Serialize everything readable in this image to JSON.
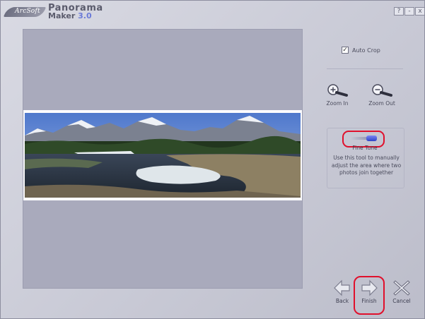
{
  "app": {
    "brand": "ArcSoft",
    "name_line1": "Panorama",
    "name_line2": "Maker",
    "version": "3.0"
  },
  "window_controls": {
    "help": "?",
    "minimize": "-",
    "close": "x"
  },
  "options": {
    "auto_crop_label": "Auto Crop",
    "auto_crop_checked": true
  },
  "zoom": {
    "zoom_in_label": "Zoom In",
    "zoom_out_label": "Zoom Out"
  },
  "fine_tune": {
    "label": "Fine Tune",
    "description": "Use this tool to manually adjust the area where two photos join together"
  },
  "nav": {
    "back_label": "Back",
    "finish_label": "Finish",
    "cancel_label": "Cancel"
  },
  "colors": {
    "highlight": "#e0102c",
    "accent": "#6b7bd8",
    "sky": "#5a82d0"
  }
}
